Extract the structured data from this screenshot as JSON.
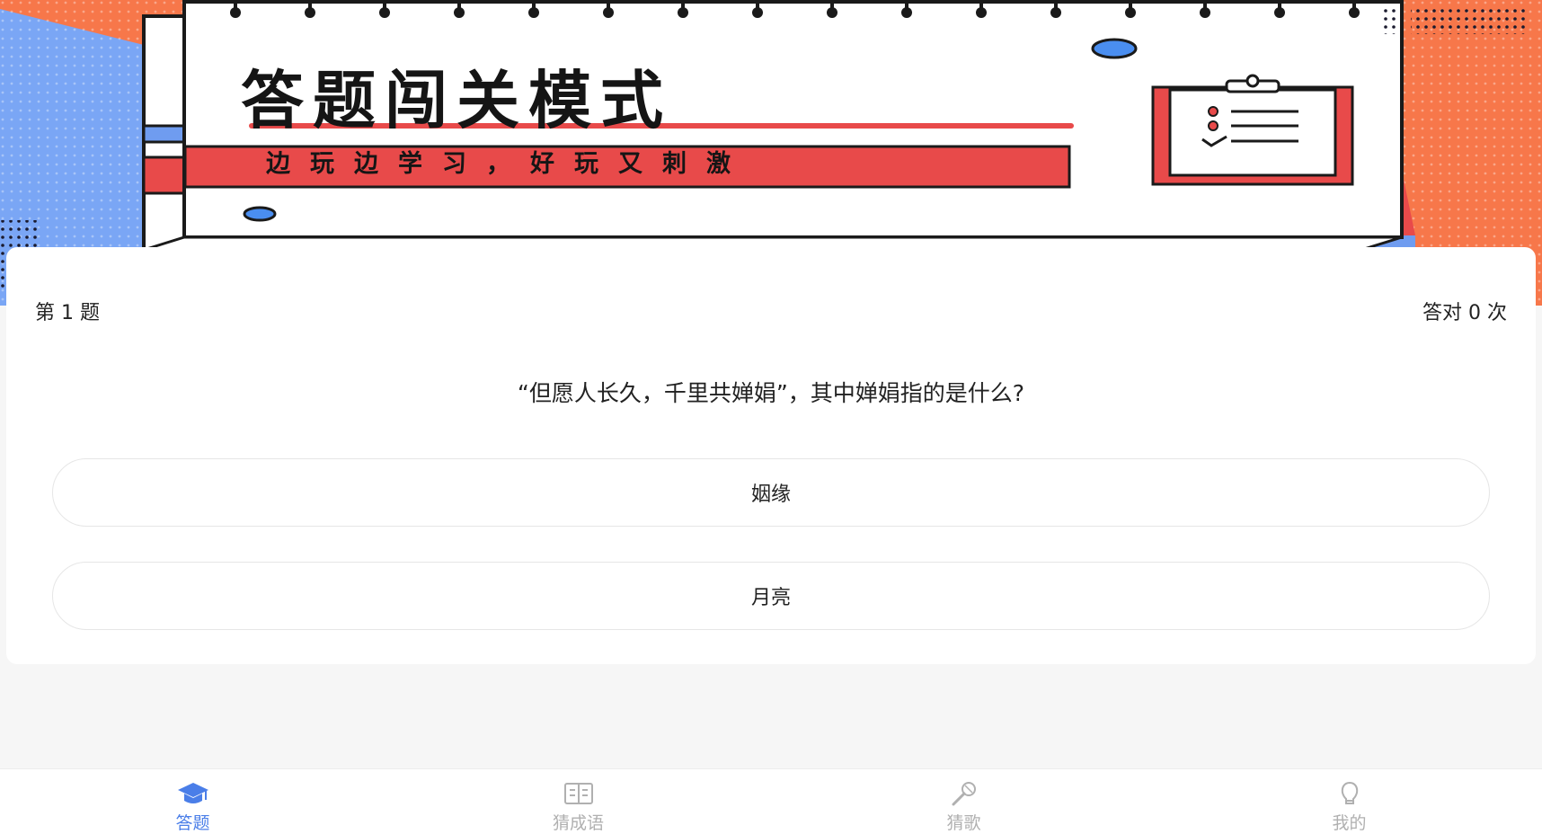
{
  "banner": {
    "title": "答题闯关模式",
    "subtitle": "边玩边学习，好玩又刺激"
  },
  "quiz": {
    "question_index": "第 1 题",
    "score": "答对 0 次",
    "question": "“但愿人长久，千里共婵娟”，其中婵娟指的是什么?",
    "options": [
      "姻缘",
      "月亮"
    ]
  },
  "tabbar": {
    "items": [
      {
        "label": "答题",
        "icon": "graduation-cap-icon",
        "active": true
      },
      {
        "label": "猜成语",
        "icon": "book-icon",
        "active": false
      },
      {
        "label": "猜歌",
        "icon": "microphone-icon",
        "active": false
      },
      {
        "label": "我的",
        "icon": "user-icon",
        "active": false
      }
    ]
  },
  "colors": {
    "accent": "#4a7ee8",
    "banner_orange": "#f7774a",
    "banner_blue": "#6f9cf0",
    "banner_red": "#e84a4a",
    "inactive": "#b0b0b0"
  }
}
